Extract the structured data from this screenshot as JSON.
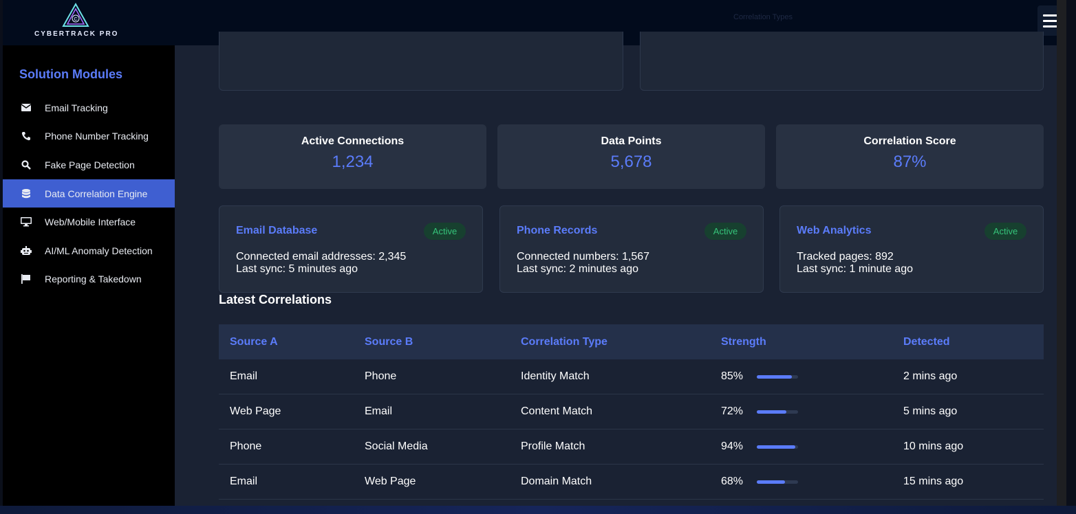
{
  "brand": {
    "name": "CYBERTRACK PRO",
    "ghost_text": "Correlation Types"
  },
  "sidebar": {
    "title": "Solution Modules",
    "items": [
      {
        "label": "Email Tracking",
        "icon": "envelope-icon",
        "active": false
      },
      {
        "label": "Phone Number Tracking",
        "icon": "phone-icon",
        "active": false
      },
      {
        "label": "Fake Page Detection",
        "icon": "search-icon",
        "active": false
      },
      {
        "label": "Data Correlation Engine",
        "icon": "database-icon",
        "active": true
      },
      {
        "label": "Web/Mobile Interface",
        "icon": "desktop-icon",
        "active": false
      },
      {
        "label": "AI/ML Anomaly Detection",
        "icon": "robot-icon",
        "active": false
      },
      {
        "label": "Reporting & Takedown",
        "icon": "flag-icon",
        "active": false
      }
    ]
  },
  "stats": [
    {
      "label": "Active Connections",
      "value": "1,234"
    },
    {
      "label": "Data Points",
      "value": "5,678"
    },
    {
      "label": "Correlation Score",
      "value": "87%"
    }
  ],
  "sources": [
    {
      "title": "Email Database",
      "status": "Active",
      "line1": "Connected email addresses: 2,345",
      "line2": "Last sync: 5 minutes ago"
    },
    {
      "title": "Phone Records",
      "status": "Active",
      "line1": "Connected numbers: 1,567",
      "line2": "Last sync: 2 minutes ago"
    },
    {
      "title": "Web Analytics",
      "status": "Active",
      "line1": "Tracked pages: 892",
      "line2": "Last sync: 1 minute ago"
    }
  ],
  "correlations": {
    "title": "Latest Correlations",
    "headers": [
      "Source A",
      "Source B",
      "Correlation Type",
      "Strength",
      "Detected"
    ],
    "rows": [
      {
        "source_a": "Email",
        "source_b": "Phone",
        "type": "Identity Match",
        "strength": "85%",
        "strength_value": 85,
        "detected": "2 mins ago"
      },
      {
        "source_a": "Web Page",
        "source_b": "Email",
        "type": "Content Match",
        "strength": "72%",
        "strength_value": 72,
        "detected": "5 mins ago"
      },
      {
        "source_a": "Phone",
        "source_b": "Social Media",
        "type": "Profile Match",
        "strength": "94%",
        "strength_value": 94,
        "detected": "10 mins ago"
      },
      {
        "source_a": "Email",
        "source_b": "Web Page",
        "type": "Domain Match",
        "strength": "68%",
        "strength_value": 68,
        "detected": "15 mins ago"
      }
    ]
  },
  "colors": {
    "accent": "#5b7cfa",
    "active_badge": "#36c47a",
    "sidebar_active": "#3f5fd1"
  }
}
